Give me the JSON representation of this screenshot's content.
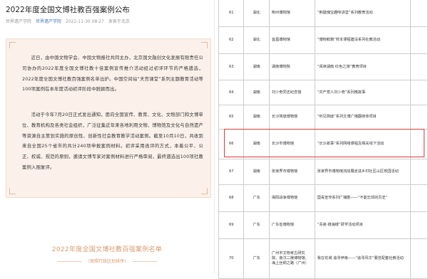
{
  "article": {
    "title": "2022年度全国文博社教百强案例公布",
    "source1": "世界遗产学院",
    "source2": "世界遗产学院",
    "datetime": "2022-11-30 08:27",
    "location": "发表于北京",
    "paragraph1": "近日，由中国文物学会、中国文物报社共同主办，北京国文融创文化发展有限责任公司协办的2022年度全国文博社教十佳案例宣传推介活动经过初评环节的严格遴选，2022年度全国文博社教百强案例名单出炉。中国空间站“天宫课堂”系列主题教育活动等100项案例在本年度活动初评阶段中脱颖而出。",
    "paragraph2": "活动于今年7月20日正式发出通知，面向全国宣传、教育、文化、文物部门和文博单位、教育机构及各类社会组织，广泛征集近年来各地利用文物、博物馆及文化与自然遗产等资源自主策划实施的原创性、创新性社会教育教学活动案例。截至10月10日，共收到来自全国25个省市的共计240项申报案例材料。初评采用函评的方式，本着公平、公正、权威、规范的原则，邀请文博专家对案例材料进行严格审阅，最终遴选出100项社教案例入围复评。",
    "section_title": "2022年度全国文博社教百强案例名单",
    "section_subtitle": "（按照行政区划排序）"
  },
  "table": {
    "rows": [
      {
        "no": "61",
        "prov": "湖北",
        "museum": "荆州博物馆",
        "case": "“荆楚瑰宝趣味讲堂”系列教育活动"
      },
      {
        "no": "62",
        "prov": "湖北",
        "museum": "宜昌博物馆",
        "case": "“博物鲜蔬”校本课程建设系列社教活动"
      },
      {
        "no": "63",
        "prov": "湖南",
        "museum": "湖南博物院",
        "case": "“阅读湖南 红色之旅”教育项目"
      },
      {
        "no": "64",
        "prov": "湖南",
        "museum": "刘少奇同志纪念馆",
        "case": "“共产党人刘少奇”系列微故事"
      },
      {
        "no": "65",
        "prov": "湖南",
        "museum": "长沙简牍博物馆",
        "case": "“听见简牍”系列文博广播翻夜体项目"
      },
      {
        "no": "66",
        "prov": "湖南",
        "museum": "长沙市博物馆",
        "case": "“长沙故事”系列网络课程及相关线下活动"
      },
      {
        "no": "67",
        "prov": "湖南",
        "museum": "张家界市博物馆",
        "case": "张家界市博物馆流动展走进乡村社区山区校园活动"
      },
      {
        "no": "68",
        "prov": "广东",
        "museum": "揭阳战争博物馆",
        "case": "国毒宣传系列广播剧——“不能忘却的历史”"
      },
      {
        "no": "69",
        "prov": "广东",
        "museum": "广东省博物馆",
        "case": "“青瓷·镜海楼”研学活动项目"
      },
      {
        "no": "70",
        "prov": "广东",
        "museum": "广州市文物考古研究院、南汉二陵博物馆、海上丝绸之路（广州）",
        "case": "我在花城 追寻伊南——“追寻风华”展览配套社教活动"
      }
    ]
  }
}
